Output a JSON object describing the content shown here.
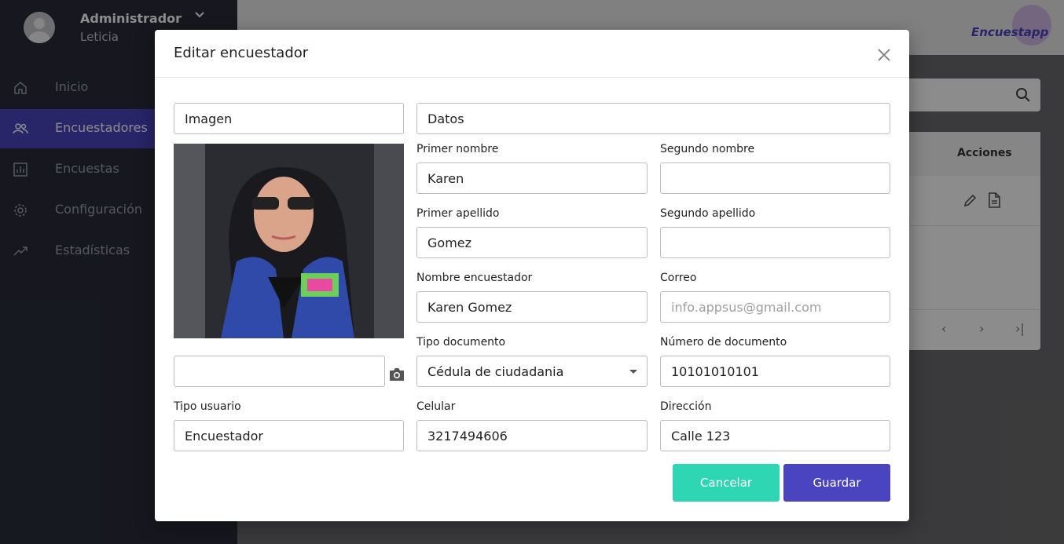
{
  "sidebar": {
    "user_name": "Administrador",
    "user_role": "Leticia",
    "items": [
      {
        "label": "Inicio",
        "icon": "home-icon"
      },
      {
        "label": "Encuestadores",
        "icon": "users-icon"
      },
      {
        "label": "Encuestas",
        "icon": "bar-chart-icon"
      },
      {
        "label": "Configuración",
        "icon": "gear-icon"
      },
      {
        "label": "Estadísticas",
        "icon": "trending-icon"
      }
    ]
  },
  "topbar": {
    "logo_text": "Encuestapp"
  },
  "table": {
    "actions_header": "Acciones"
  },
  "modal": {
    "title": "Editar encuestador",
    "image_section": "Imagen",
    "data_section": "Datos",
    "fields": {
      "primer_nombre": {
        "label": "Primer nombre",
        "value": "Karen"
      },
      "segundo_nombre": {
        "label": "Segundo nombre",
        "value": ""
      },
      "primer_apellido": {
        "label": "Primer apellido",
        "value": "Gomez"
      },
      "segundo_apellido": {
        "label": "Segundo apellido",
        "value": ""
      },
      "nombre_encuestador": {
        "label": "Nombre encuestador",
        "value": "Karen Gomez"
      },
      "correo": {
        "label": "Correo",
        "value": "",
        "placeholder": "info.appsus@gmail.com"
      },
      "tipo_documento": {
        "label": "Tipo documento",
        "value": "Cédula de ciudadania"
      },
      "numero_documento": {
        "label": "Número de documento",
        "value": "10101010101"
      },
      "tipo_usuario": {
        "label": "Tipo usuario",
        "value": "Encuestador"
      },
      "celular": {
        "label": "Celular",
        "value": "3217494606"
      },
      "direccion": {
        "label": "Dirección",
        "value": "Calle 123"
      }
    },
    "cancel_label": "Cancelar",
    "save_label": "Guardar"
  },
  "colors": {
    "primary": "#4a44c0",
    "accent": "#2fd6b4",
    "sidebar": "#2a2d3a"
  }
}
